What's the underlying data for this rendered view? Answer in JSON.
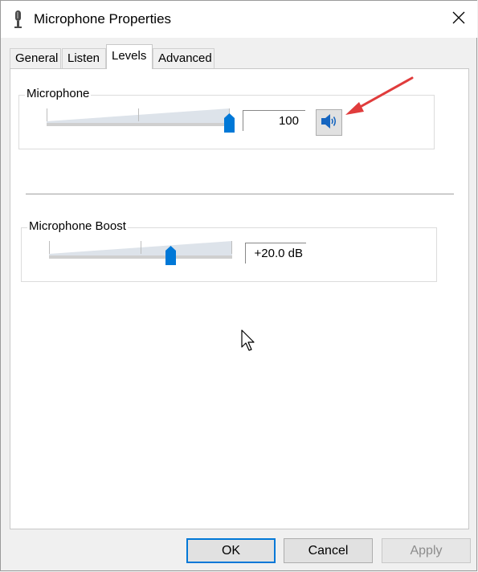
{
  "window": {
    "title": "Microphone Properties"
  },
  "tabs": [
    {
      "label": "General",
      "active": false
    },
    {
      "label": "Listen",
      "active": false
    },
    {
      "label": "Levels",
      "active": true
    },
    {
      "label": "Advanced",
      "active": false
    }
  ],
  "levels": {
    "microphone": {
      "label": "Microphone",
      "value": "100",
      "level_fraction": 1.0
    },
    "boost": {
      "label": "Microphone Boost",
      "value": "+20.0 dB",
      "level_fraction": 0.667
    }
  },
  "buttons": {
    "ok": "OK",
    "cancel": "Cancel",
    "apply": "Apply"
  },
  "colors": {
    "accent": "#0078d7",
    "annotation_arrow": "#e03c3c",
    "speaker": "#1565c0"
  },
  "icons": [
    "microphone-icon",
    "close-icon",
    "speaker-icon",
    "red-arrow-annotation",
    "mouse-cursor-icon"
  ]
}
